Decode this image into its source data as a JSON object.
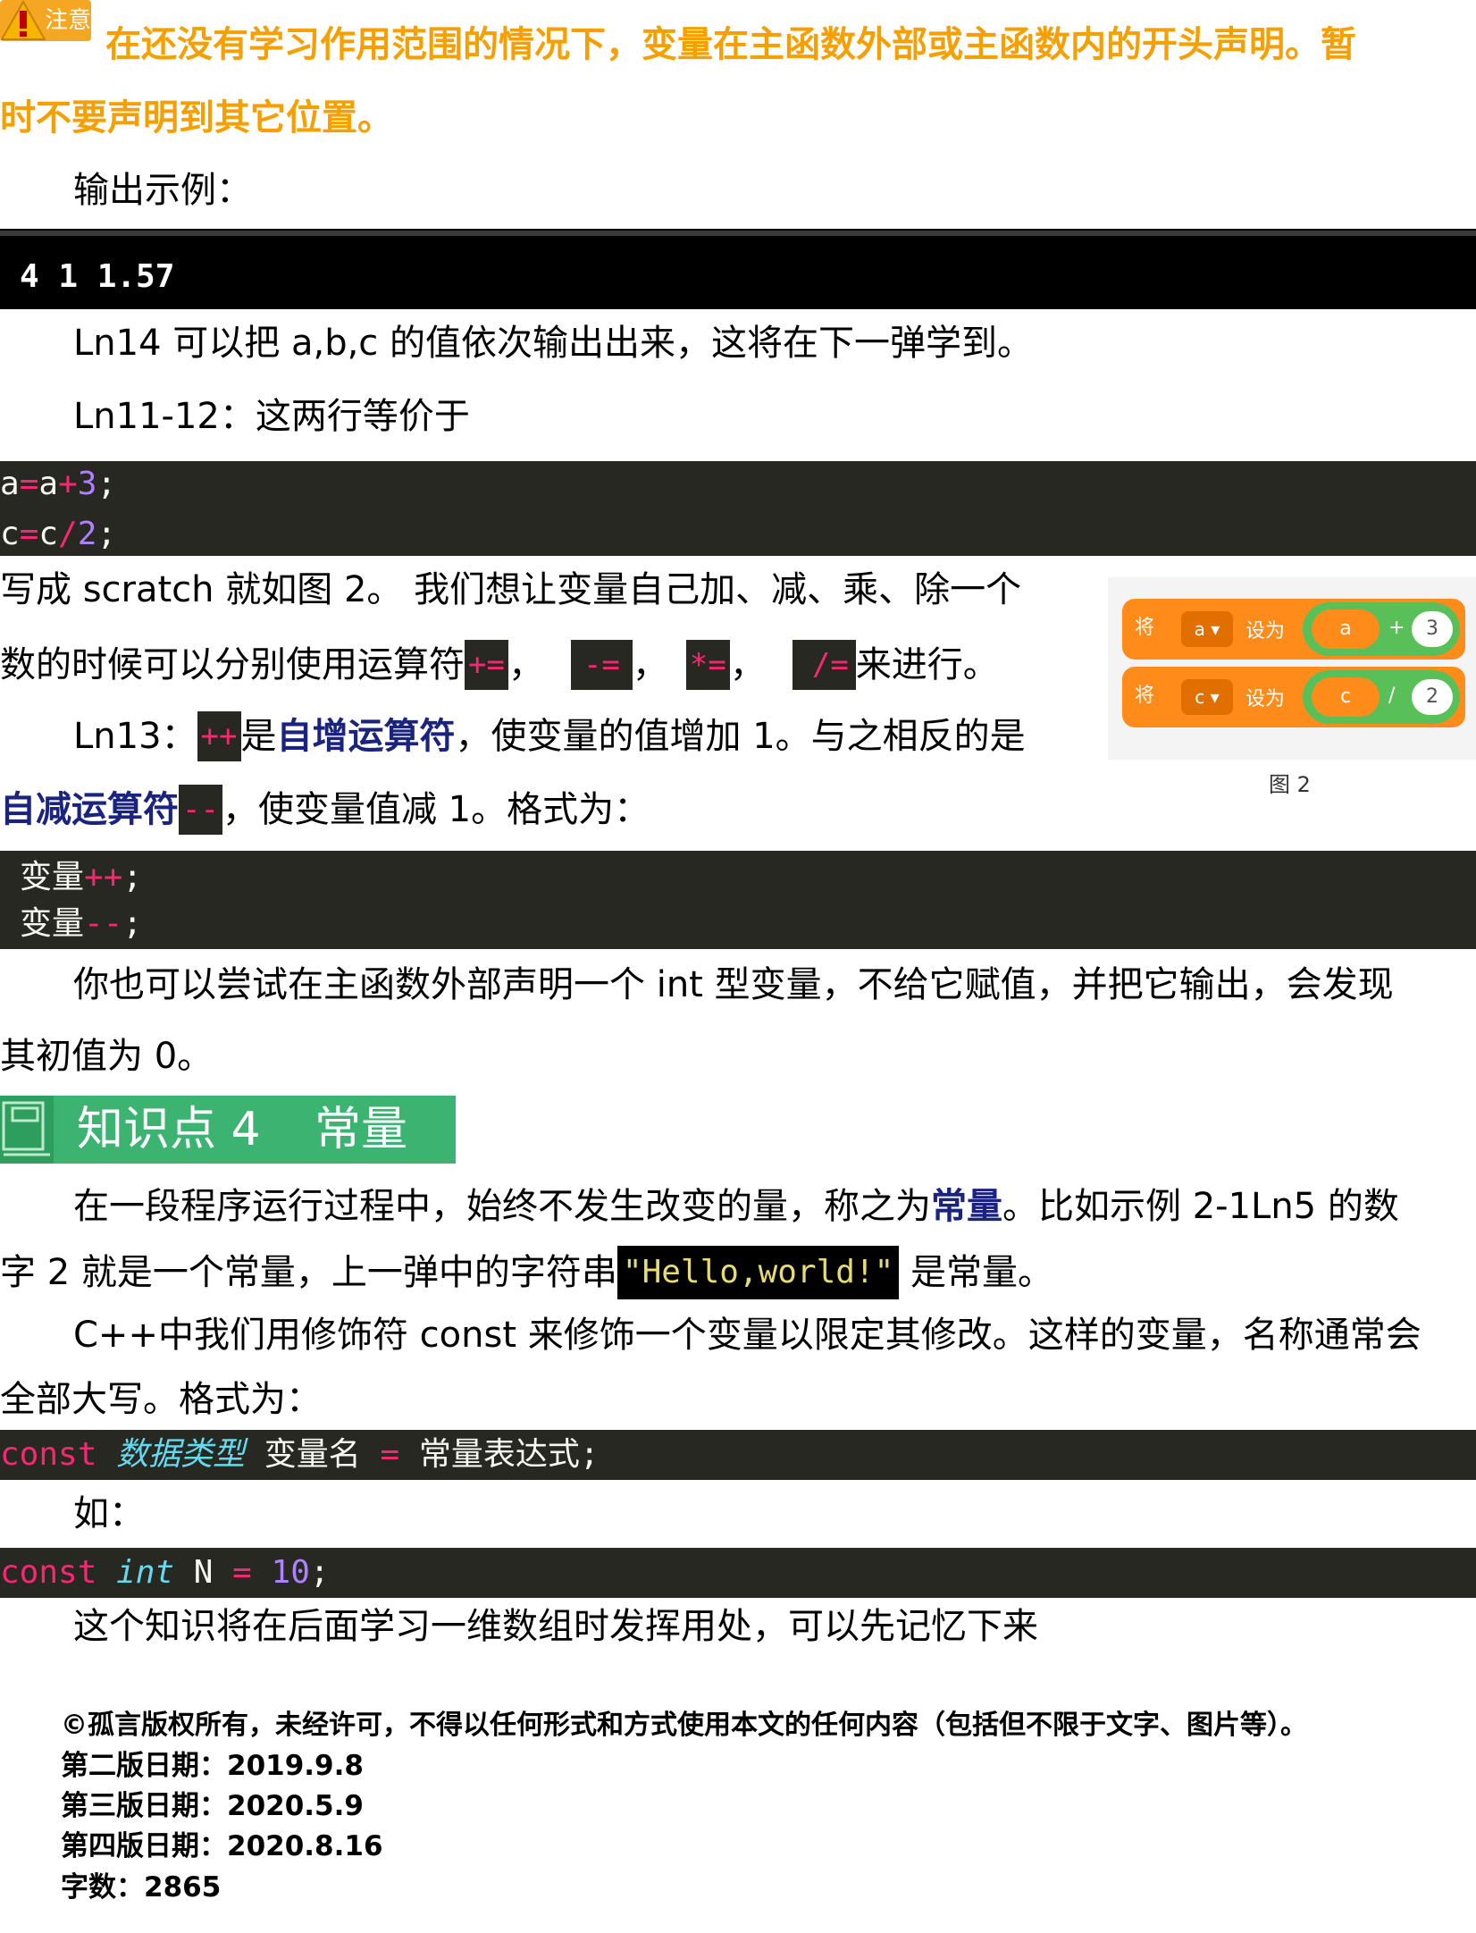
{
  "warning": {
    "badge_label": "注意",
    "text_line1": "在还没有学习作用范围的情况下，变量在主函数外部或主函数内的开头声明。暂",
    "text_line2": "时不要声明到其它位置。"
  },
  "output_label": "输出示例：",
  "output_value": "4 1 1.57",
  "para_ln14": "Ln14 可以把 a,b,c 的值依次输出出来，这将在下一弹学到。",
  "para_ln11": "Ln11-12：这两行等价于",
  "code1": {
    "line1": {
      "var": "a",
      "eq": "=",
      "var2": "a",
      "op": "+",
      "num": "3",
      "end": ";"
    },
    "line2": {
      "var": "c",
      "eq": "=",
      "var2": "c",
      "op": "/",
      "num": "2",
      "end": ";"
    }
  },
  "scratch_para": {
    "line1": "写成 scratch 就如图 2。 我们想让变量自己加、减、乘、除一个",
    "line2_pre": "数的时候可以分别使用运算符",
    "op1": "+=",
    "sep1": "，",
    "op2": "-=",
    "sep2": "，",
    "op3": "*=",
    "sep3": "，",
    "op4": "/=",
    "line2_post": "来进行。"
  },
  "ln13": {
    "pre": "Ln13：",
    "op_inc": "++",
    "mid1": "是",
    "term_inc": "自增运算符",
    "mid2": "，使变量的值增加 1。与之相反的是",
    "term_dec": "自减运算符",
    "op_dec": "--",
    "post": "，使变量值减 1。格式为："
  },
  "code2": {
    "line1_var": "变量",
    "line1_op": "++",
    "line1_end": ";",
    "line2_var": "变量",
    "line2_op": "--",
    "line2_end": ";"
  },
  "para_init_line1": "你也可以尝试在主函数外部声明一个 int 型变量，不给它赋值，并把它输出，会发现",
  "para_init_line2": "其初值为 0。",
  "figure": {
    "block1": {
      "label_set": "将",
      "var": "a",
      "to": "设为",
      "arg": "a",
      "op": "+",
      "num": "3"
    },
    "block2": {
      "label_set": "将",
      "var": "c",
      "to": "设为",
      "arg": "c",
      "op": "/",
      "num": "2"
    },
    "caption": "图 2"
  },
  "section": {
    "title": "知识点 4",
    "subtitle": "常量",
    "color": "#3cb371"
  },
  "const_para": {
    "line1_pre": "在一段程序运行过程中，始终不发生改变的量，称之为",
    "term": "常量",
    "line1_post": "。比如示例 2-1Ln5 的数",
    "line2_pre": "字 2 就是一个常量，上一弹中的字符串",
    "string": "\"Hello,world!\"",
    "line2_post": " 是常量。",
    "line3": "C++中我们用修饰符 const 来修饰一个变量以限定其修改。这样的变量，名称通常会",
    "line4": "全部大写。格式为："
  },
  "code3": {
    "kw": "const",
    "type": "数据类型",
    "name": "变量名",
    "eq": "=",
    "expr": "常量表达式",
    "end": ";"
  },
  "example_label": "如：",
  "code4": {
    "kw": "const",
    "type": "int",
    "name": "N",
    "eq": "=",
    "num": "10",
    "end": ";"
  },
  "closing": "这个知识将在后面学习一维数组时发挥用处，可以先记忆下来",
  "footer": {
    "copyright": "©孤言版权所有，未经许可，不得以任何形式和方式使用本文的任何内容（包括但不限于文字、图片等）。",
    "v2": "第二版日期：2019.9.8",
    "v3": "第三版日期：2020.5.9",
    "v4": "第四版日期：2020.8.16",
    "words": "字数：2865"
  }
}
